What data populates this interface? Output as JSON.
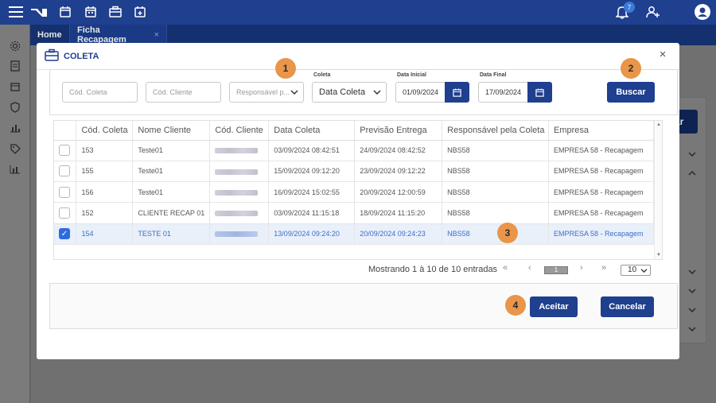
{
  "colors": {
    "primary": "#1f3f8f",
    "callout": "#e9954a",
    "selected_row": "#e9f0fa"
  },
  "topbar": {
    "notification_count": "7",
    "icons": [
      "menu-icon",
      "logo-icon",
      "calendar-icon",
      "calendar-check-icon",
      "briefcase-icon",
      "calendar-add-icon",
      "bell-icon",
      "user-add-icon",
      "account-icon"
    ]
  },
  "tabs": [
    {
      "label": "Home"
    },
    {
      "label": "Ficha Recapagem",
      "close": "×"
    }
  ],
  "background": {
    "button_label": "ar"
  },
  "modal": {
    "title": "COLETA",
    "close": "×",
    "filters": {
      "cod_coleta_placeholder": "Cód. Coleta",
      "cod_cliente_placeholder": "Cód. Cliente",
      "responsavel_placeholder": "Responsável p...",
      "coleta_label": "Coleta",
      "coleta_value": "Data Coleta",
      "data_inicial_label": "Data Inicial",
      "data_inicial_value": "01/09/2024",
      "data_final_label": "Data Final",
      "data_final_value": "17/09/2024",
      "search_label": "Buscar"
    },
    "table": {
      "headers": [
        "Cód. Coleta",
        "Nome Cliente",
        "Cód. Cliente",
        "Data Coleta",
        "Previsão Entrega",
        "Responsável pela Coleta",
        "Empresa"
      ],
      "rows": [
        {
          "checked": false,
          "cod_coleta": "153",
          "nome_cliente": "Teste01",
          "data_coleta": "03/09/2024 08:42:51",
          "previsao": "24/09/2024 08:42:52",
          "responsavel": "NBS58",
          "empresa": "EMPRESA 58 - Recapagem"
        },
        {
          "checked": false,
          "cod_coleta": "155",
          "nome_cliente": "Teste01",
          "data_coleta": "15/09/2024 09:12:20",
          "previsao": "23/09/2024 09:12:22",
          "responsavel": "NBS58",
          "empresa": "EMPRESA 58 - Recapagem"
        },
        {
          "checked": false,
          "cod_coleta": "156",
          "nome_cliente": "Teste01",
          "data_coleta": "16/09/2024 15:02:55",
          "previsao": "20/09/2024 12:00:59",
          "responsavel": "NBS58",
          "empresa": "EMPRESA 58 - Recapagem"
        },
        {
          "checked": false,
          "cod_coleta": "152",
          "nome_cliente": "CLIENTE RECAP 01",
          "data_coleta": "03/09/2024 11:15:18",
          "previsao": "18/09/2024 11:15:20",
          "responsavel": "NBS58",
          "empresa": "EMPRESA 58 - Recapagem"
        },
        {
          "checked": true,
          "cod_coleta": "154",
          "nome_cliente": "TESTE 01",
          "data_coleta": "13/09/2024 09:24:20",
          "previsao": "20/09/2024 09:24:23",
          "responsavel": "NBS58",
          "empresa": "EMPRESA 58 - Recapagem"
        }
      ]
    },
    "pagination": {
      "summary": "Mostrando 1 à 10 de 10 entradas",
      "first": "«",
      "prev": "‹",
      "current_page": "1",
      "next": "›",
      "last": "»",
      "page_size": "10"
    },
    "footer": {
      "accept_label": "Aceitar",
      "cancel_label": "Cancelar"
    }
  },
  "callouts": [
    "1",
    "2",
    "3",
    "4"
  ]
}
